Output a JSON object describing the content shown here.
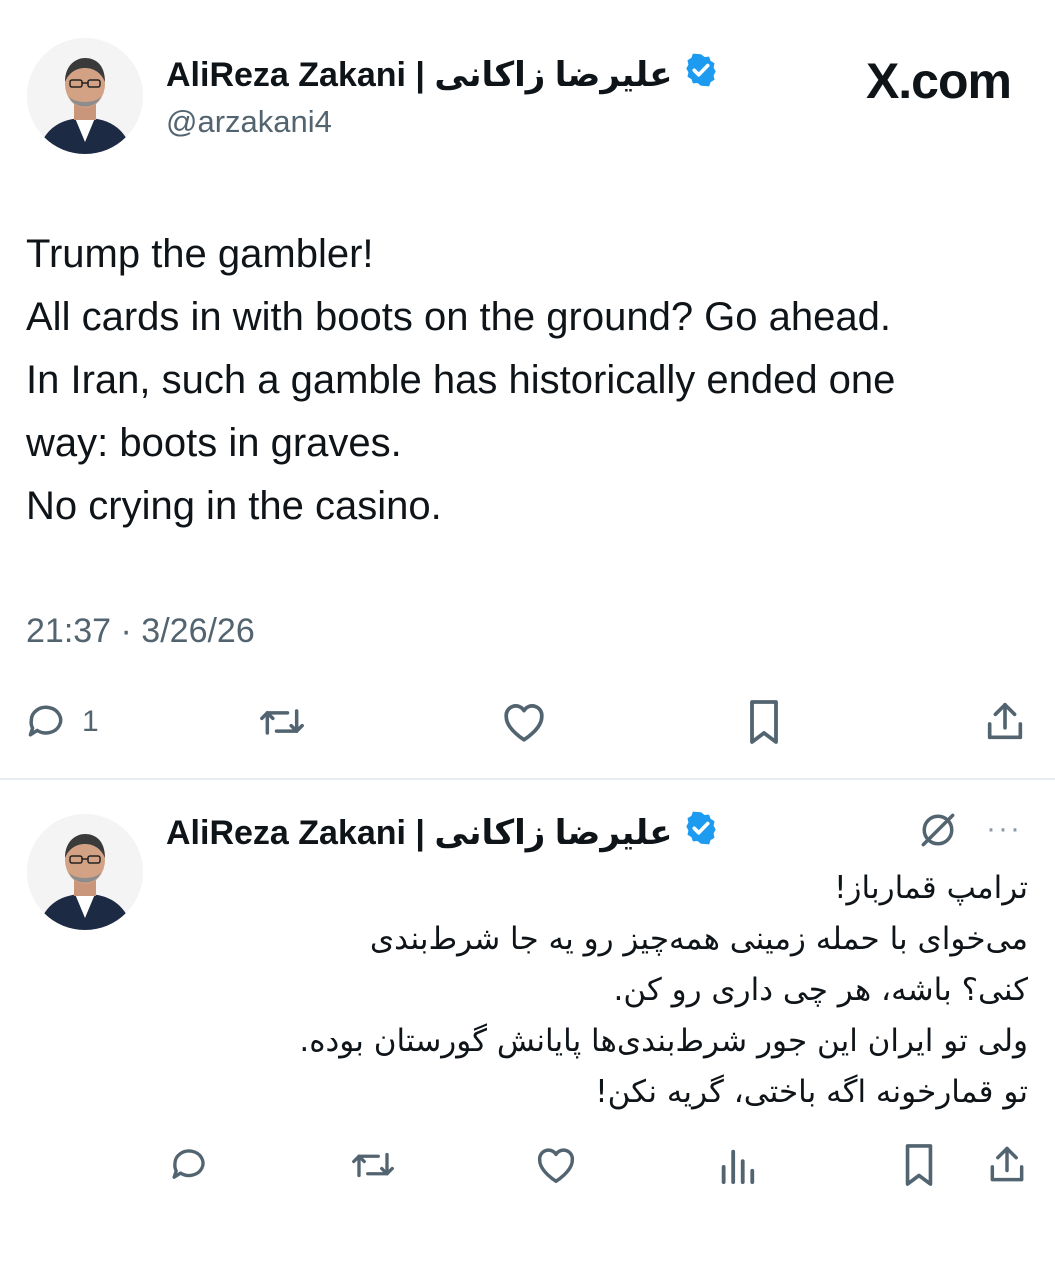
{
  "brand": {
    "label": "X.com"
  },
  "tweet1": {
    "author_name": "AliReza Zakani | علیرضا زاکانی",
    "handle": "@arzakani4",
    "lines": [
      "Trump the gambler!",
      "All cards in with boots on the ground? Go ahead.",
      "In Iran, such a gamble has historically ended one",
      "way: boots in graves.",
      "No crying in the casino."
    ],
    "timestamp": "21:37 · 3/26/26",
    "reply_count": "1",
    "icons": [
      "reply-icon",
      "retweet-icon",
      "like-icon",
      "bookmark-icon",
      "share-icon"
    ]
  },
  "tweet2": {
    "author_name": "AliReza Zakani | علیرضا زاکانی",
    "more_label": "···",
    "lines": [
      "ترامپ قمارباز!",
      "می‌خوای با حمله زمینی همه‌چیز رو یه جا شرط‌بندی",
      "کنی؟ باشه، هر چی داری رو کن.",
      "ولی تو ایران این جور شرط‌بندی‌ها پایانش گورستان بوده.",
      "تو قمارخونه اگه باختی، گریه نکن!"
    ],
    "icons": [
      "reply-icon",
      "retweet-icon",
      "like-icon",
      "views-icon",
      "bookmark-icon",
      "share-icon"
    ]
  },
  "colors": {
    "verified": "#1d9bf0",
    "muted": "#536471",
    "text": "#0f1419"
  }
}
